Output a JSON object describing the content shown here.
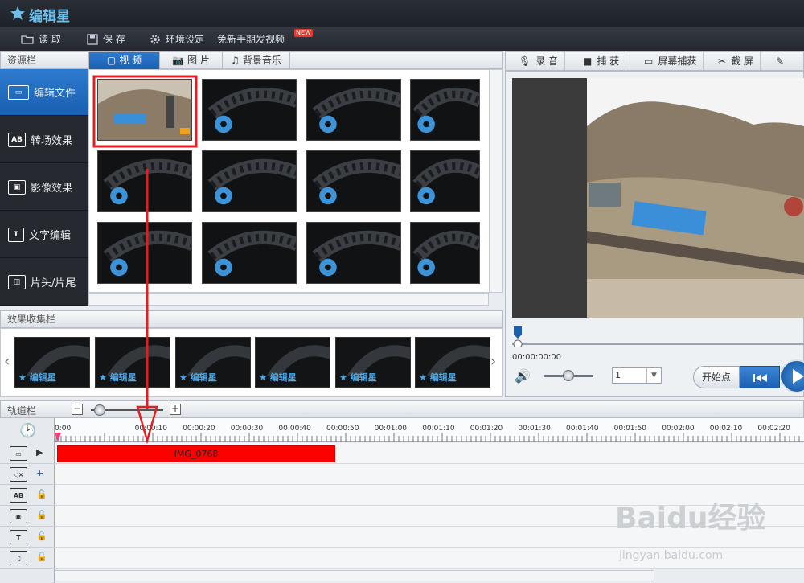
{
  "app": {
    "title": "编辑星"
  },
  "menu": {
    "open": "读 取",
    "save": "保 存",
    "settings": "环境设定",
    "publish": "免新手期发视频",
    "new_badge": "NEW"
  },
  "resource": {
    "header": "资源栏",
    "sidebar": [
      {
        "label": "编辑文件",
        "icon": "film-icon"
      },
      {
        "label": "转场效果",
        "icon": "ab-transition-icon"
      },
      {
        "label": "影像效果",
        "icon": "image-effect-icon"
      },
      {
        "label": "文字编辑",
        "icon": "text-icon"
      },
      {
        "label": "片头/片尾",
        "icon": "intro-outro-icon"
      }
    ],
    "tabs": [
      {
        "label": "视 频",
        "icon": "video-icon"
      },
      {
        "label": "图 片",
        "icon": "camera-icon"
      },
      {
        "label": "背景音乐",
        "icon": "music-icon"
      }
    ]
  },
  "effects": {
    "header": "效果收集栏",
    "item_label": "编辑星"
  },
  "right_toolbar": {
    "record": "录 音",
    "capture": "捕 获",
    "screen_capture": "屏幕捕获",
    "screenshot": "截 屏"
  },
  "player": {
    "timecode": "00:00:00:00",
    "speed": "1",
    "start_point": "开始点"
  },
  "timeline": {
    "header": "轨道栏",
    "ticks": [
      "0:00",
      "00:00:10",
      "00:00:20",
      "00:00:30",
      "00:00:40",
      "00:00:50",
      "00:01:00",
      "00:01:10",
      "00:01:20",
      "00:01:30",
      "00:01:40",
      "00:01:50",
      "00:02:00",
      "00:02:10",
      "00:02:20",
      "00:02:30"
    ],
    "clip_name": "IMG_0768"
  },
  "watermark": {
    "brand": "Baidu经验",
    "url": "jingyan.baidu.com"
  },
  "colors": {
    "accent": "#1b5fb0",
    "clip": "#ff0000",
    "annotation": "#e02020"
  }
}
